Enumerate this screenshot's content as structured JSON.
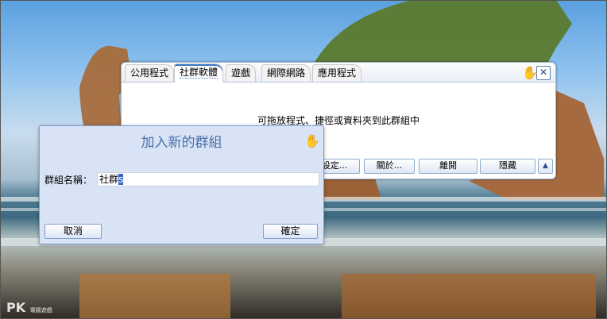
{
  "launcher": {
    "tabs": [
      {
        "label": "公用程式"
      },
      {
        "label": "社群軟體"
      },
      {
        "label": "遊戲"
      },
      {
        "label": "網際網路"
      },
      {
        "label": "應用程式"
      }
    ],
    "active_tab": "社群軟體",
    "close_label": "✕",
    "drop_hint": "可拖放程式、捷徑或資料夾到此群組中",
    "buttons": {
      "settings": "設定...",
      "about": "關於...",
      "exit": "離開",
      "hide": "隱藏"
    },
    "collapse_label": "▲"
  },
  "dialog": {
    "title": "加入新的群組",
    "group_name_label": "群組名稱：",
    "group_name_value": "社群",
    "group_name_selected": "s",
    "cancel_label": "取消",
    "ok_label": "確定"
  },
  "watermark": {
    "logo": "PK",
    "text": "電腦遊戲"
  },
  "colors": {
    "accent": "#3b78c9",
    "dialog_bg": "#d8e3f5",
    "dialog_title": "#4c70a8"
  }
}
